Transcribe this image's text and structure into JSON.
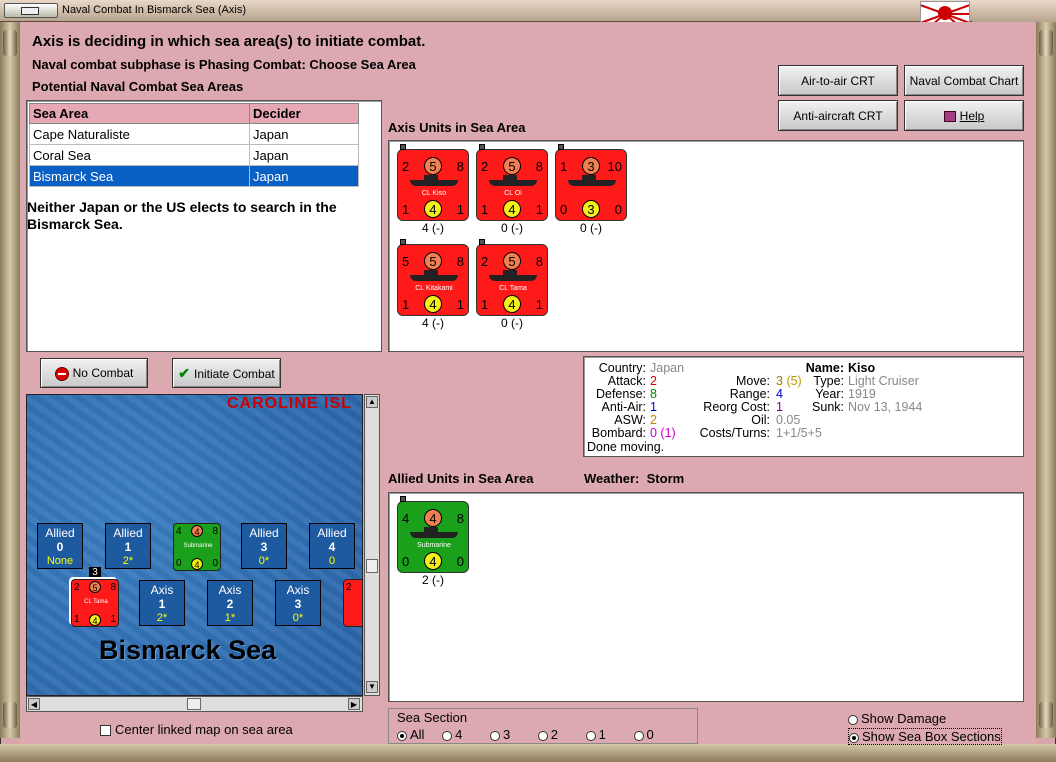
{
  "window": {
    "title": "Naval Combat In Bismarck Sea (Axis)",
    "flag_icon": "rising-sun-flag-icon"
  },
  "header": {
    "line1": "Axis is deciding in which sea area(s) to initiate combat.",
    "line2": "Naval combat subphase is Phasing Combat: Choose Sea Area",
    "line3": "Potential Naval Combat Sea Areas"
  },
  "buttons": {
    "air_to_air": "Air-to-air CRT",
    "naval_chart": "Naval Combat Chart",
    "anti_aircraft": "Anti-aircraft CRT",
    "help": "Help",
    "no_combat": "No Combat",
    "initiate_combat": "Initiate Combat"
  },
  "sea_table": {
    "headers": [
      "Sea Area",
      "Decider"
    ],
    "rows": [
      {
        "area": "Cape Naturaliste",
        "decider": "Japan"
      },
      {
        "area": "Coral Sea",
        "decider": "Japan"
      },
      {
        "area": "Bismarck Sea",
        "decider": "Japan"
      }
    ],
    "selected_index": 2
  },
  "search_message": "Neither Japan or the US elects to search in the Bismarck Sea.",
  "axis_units": {
    "label": "Axis Units in Sea Area",
    "units": [
      {
        "tl": "2",
        "top": "5",
        "tr": "8",
        "bl": "1",
        "bot": "4",
        "br": "1",
        "name": "CL Kiso",
        "caption": "4 (-)"
      },
      {
        "tl": "2",
        "top": "5",
        "tr": "8",
        "bl": "1",
        "bot": "4",
        "br": "1",
        "name": "CL Oi",
        "caption": "0 (-)"
      },
      {
        "tl": "1",
        "top": "3",
        "tr": "10",
        "bl": "0",
        "bot": "3",
        "br": "0",
        "name": "",
        "caption": "0 (-)"
      },
      {
        "tl": "5",
        "top": "5",
        "tr": "8",
        "bl": "1",
        "bot": "4",
        "br": "1",
        "name": "CL Kitakami",
        "caption": "4 (-)"
      },
      {
        "tl": "2",
        "top": "5",
        "tr": "8",
        "bl": "1",
        "bot": "4",
        "br": "1",
        "name": "CL Tama",
        "caption": "0 (-)"
      }
    ]
  },
  "info": {
    "country_label": "Country:",
    "country": "Japan",
    "attack_label": "Attack:",
    "attack": "2",
    "defense_label": "Defense:",
    "defense": "8",
    "antiair_label": "Anti-Air:",
    "antiair": "1",
    "asw_label": "ASW:",
    "asw": "2",
    "bombard_label": "Bombard:",
    "bombard": "0 (1)",
    "name_label": "Name:",
    "name": "Kiso",
    "move_label": "Move:",
    "move": "3",
    "move_extra": "(5)",
    "type_label": "Type:",
    "type": "Light Cruiser",
    "range_label": "Range:",
    "range": "4",
    "year_label": "Year:",
    "year": "1919",
    "reorg_label": "Reorg Cost:",
    "reorg": "1",
    "sunk_label": "Sunk:",
    "sunk": "Nov 13, 1944",
    "oil_label": "Oil:",
    "oil": "0.05",
    "costs_label": "Costs/Turns:",
    "costs": "1+1/5+5",
    "status": "Done moving."
  },
  "allied_units": {
    "label": "Allied Units in Sea Area",
    "weather_label": "Weather:",
    "weather": "Storm",
    "units": [
      {
        "tl": "4",
        "top": "4",
        "tr": "8",
        "bl": "0",
        "bot": "4",
        "br": "0",
        "name": "Submarine",
        "caption": "2 (-)"
      }
    ]
  },
  "map": {
    "region_label": "CAROLINE ISL",
    "sea_label": "Bismarck Sea",
    "allied_boxes": [
      {
        "title": "Allied",
        "num": "0",
        "sub": "None"
      },
      {
        "title": "Allied",
        "num": "1",
        "sub": "2*"
      },
      {
        "title": "Allied",
        "num": "3",
        "sub": "0*"
      },
      {
        "title": "Allied",
        "num": "4",
        "sub": "0"
      }
    ],
    "axis_boxes": [
      {
        "title": "Axis",
        "num": "1",
        "sub": "2*"
      },
      {
        "title": "Axis",
        "num": "2",
        "sub": "1*"
      },
      {
        "title": "Axis",
        "num": "3",
        "sub": "0*"
      }
    ],
    "stack_count": "3",
    "mini_sub": {
      "tl": "4",
      "top": "4",
      "tr": "8",
      "bl": "0",
      "bot": "4",
      "br": "0",
      "name": "Submarine"
    },
    "mini_red": {
      "tl": "2",
      "top": "5",
      "tr": "8",
      "bl": "1",
      "bot": "4",
      "br": "1",
      "name": "CL Tama"
    },
    "mini_edge": {
      "tl": "2"
    }
  },
  "center_map_label": "Center linked map on sea area",
  "sea_section": {
    "label": "Sea Section",
    "options": [
      "All",
      "4",
      "3",
      "2",
      "1",
      "0"
    ],
    "selected": "All"
  },
  "show_damage_label": "Show Damage",
  "show_sections_label": "Show Sea Box Sections",
  "colors": {
    "background": "#dca9b0",
    "selected_row": "#0a5fc4",
    "axis_counter": "#ff1a1a",
    "allied_counter": "#1aa01a",
    "sea": "#2a64a8"
  }
}
